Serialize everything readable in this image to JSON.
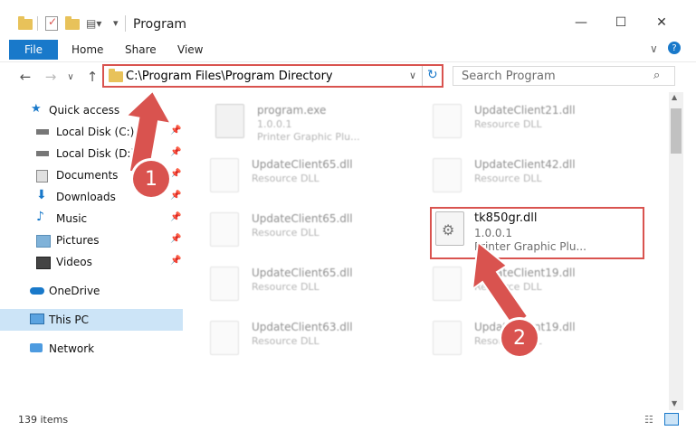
{
  "window": {
    "title": "Program"
  },
  "ribbon": {
    "file": "File",
    "home": "Home",
    "share": "Share",
    "view": "View"
  },
  "nav": {
    "address": "C:\\Program Files\\Program Directory",
    "search_placeholder": "Search Program"
  },
  "sidebar": {
    "quick_access": "Quick access",
    "items": [
      {
        "label": "Local Disk (C:)",
        "icon": "drive-icon"
      },
      {
        "label": "Local Disk (D:)",
        "icon": "drive-icon"
      },
      {
        "label": "Documents",
        "icon": "documents-icon"
      },
      {
        "label": "Downloads",
        "icon": "downloads-icon"
      },
      {
        "label": "Music",
        "icon": "music-icon"
      },
      {
        "label": "Pictures",
        "icon": "pictures-icon"
      },
      {
        "label": "Videos",
        "icon": "videos-icon"
      }
    ],
    "onedrive": "OneDrive",
    "this_pc": "This PC",
    "network": "Network"
  },
  "files": [
    {
      "name": "program.exe",
      "line1": "1.0.0.1",
      "line2": "Printer Graphic Plu..."
    },
    {
      "name": "UpdateClient21.dll",
      "line1": "Resource DLL"
    },
    {
      "name": "UpdateClient65.dll",
      "line1": "Resource DLL"
    },
    {
      "name": "UpdateClient42.dll",
      "line1": "Resource DLL"
    },
    {
      "name": "UpdateClient65.dll",
      "line1": "Resource DLL"
    },
    {
      "name": "tk850gr.dll",
      "line1": "1.0.0.1",
      "line2": "Printer Graphic Plu..."
    },
    {
      "name": "UpdateClient65.dll",
      "line1": "Resource DLL"
    },
    {
      "name": "UpdateClient19.dll",
      "line1": "Resource DLL"
    },
    {
      "name": "UpdateClient63.dll",
      "line1": "Resource DLL"
    },
    {
      "name": "UpdateClient19.dll",
      "line1": "Resource DLL"
    }
  ],
  "status": {
    "count": "139 items"
  },
  "annotations": {
    "step1": "1",
    "step2": "2"
  },
  "colors": {
    "accent": "#1979ca",
    "highlight": "#d9534f"
  }
}
